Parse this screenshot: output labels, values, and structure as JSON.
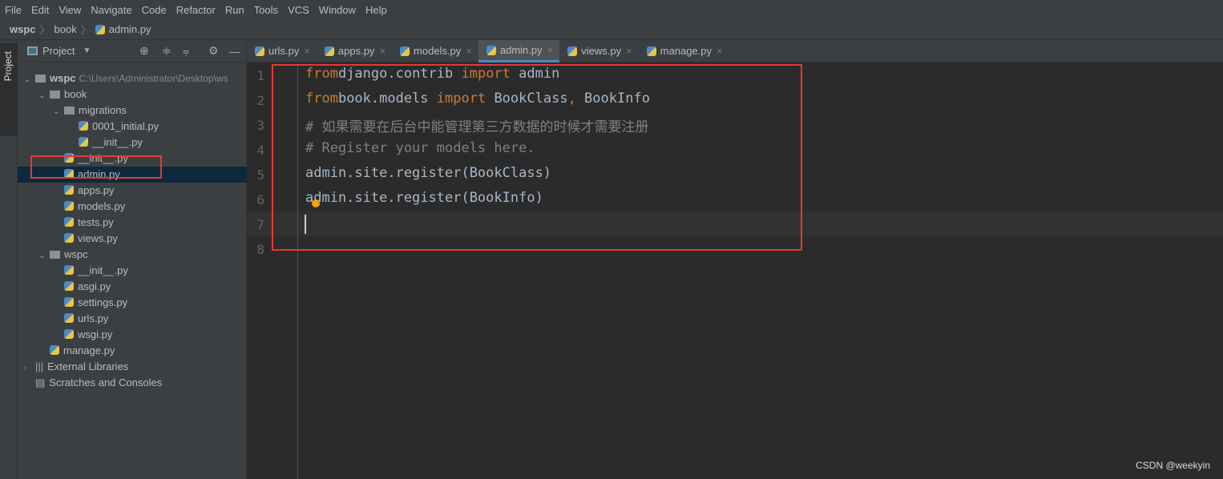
{
  "menu": [
    "File",
    "Edit",
    "View",
    "Navigate",
    "Code",
    "Refactor",
    "Run",
    "Tools",
    "VCS",
    "Window",
    "Help"
  ],
  "breadcrumb": [
    "wspc",
    "book",
    "admin.py"
  ],
  "sidebar": {
    "strip_label": "Project",
    "panel_title": "Project"
  },
  "tree": [
    {
      "label": "wspc",
      "type": "root",
      "depth": 0,
      "path": "C:\\Users\\Administrator\\Desktop\\ws"
    },
    {
      "label": "book",
      "type": "pkg",
      "depth": 1
    },
    {
      "label": "migrations",
      "type": "pkg",
      "depth": 2
    },
    {
      "label": "0001_initial.py",
      "type": "py",
      "depth": 3
    },
    {
      "label": "__init__.py",
      "type": "py",
      "depth": 3
    },
    {
      "label": "__init__.py",
      "type": "py",
      "depth": 2
    },
    {
      "label": "admin.py",
      "type": "py",
      "depth": 2,
      "selected": true
    },
    {
      "label": "apps.py",
      "type": "py",
      "depth": 2
    },
    {
      "label": "models.py",
      "type": "py",
      "depth": 2
    },
    {
      "label": "tests.py",
      "type": "py",
      "depth": 2
    },
    {
      "label": "views.py",
      "type": "py",
      "depth": 2
    },
    {
      "label": "wspc",
      "type": "pkg",
      "depth": 1
    },
    {
      "label": "__init__.py",
      "type": "py",
      "depth": 2
    },
    {
      "label": "asgi.py",
      "type": "py",
      "depth": 2
    },
    {
      "label": "settings.py",
      "type": "py",
      "depth": 2
    },
    {
      "label": "urls.py",
      "type": "py",
      "depth": 2
    },
    {
      "label": "wsgi.py",
      "type": "py",
      "depth": 2
    },
    {
      "label": "manage.py",
      "type": "py",
      "depth": 1
    },
    {
      "label": "External Libraries",
      "type": "lib",
      "depth": 0
    },
    {
      "label": "Scratches and Consoles",
      "type": "scratch",
      "depth": 0
    }
  ],
  "tabs": [
    {
      "label": "urls.py"
    },
    {
      "label": "apps.py"
    },
    {
      "label": "models.py"
    },
    {
      "label": "admin.py",
      "active": true
    },
    {
      "label": "views.py"
    },
    {
      "label": "manage.py"
    }
  ],
  "code": [
    [
      [
        "kw",
        "from"
      ],
      [
        "",
        "django.contrib "
      ],
      [
        "kw",
        "import"
      ],
      [
        "",
        " admin"
      ]
    ],
    [
      [
        "kw",
        "from"
      ],
      [
        "",
        "book.models "
      ],
      [
        "kw",
        "import"
      ],
      [
        "",
        " BookClass"
      ],
      [
        "kw",
        ","
      ],
      [
        "",
        " BookInfo"
      ]
    ],
    [
      [
        "cm",
        "# 如果需要在后台中能管理第三方数据的时候才需要注册"
      ]
    ],
    [
      [
        "cm",
        "# Register your models here."
      ]
    ],
    [
      [
        "",
        "admin.site.register(BookClass)"
      ]
    ],
    [
      [
        "",
        "admin.site.register(BookInfo)"
      ]
    ],
    [],
    []
  ],
  "watermark": "CSDN @weekyin",
  "colors": {
    "keyword": "#cc7832",
    "comment": "#808080",
    "highlight_box": "#e53935",
    "selection": "#0d293e"
  }
}
